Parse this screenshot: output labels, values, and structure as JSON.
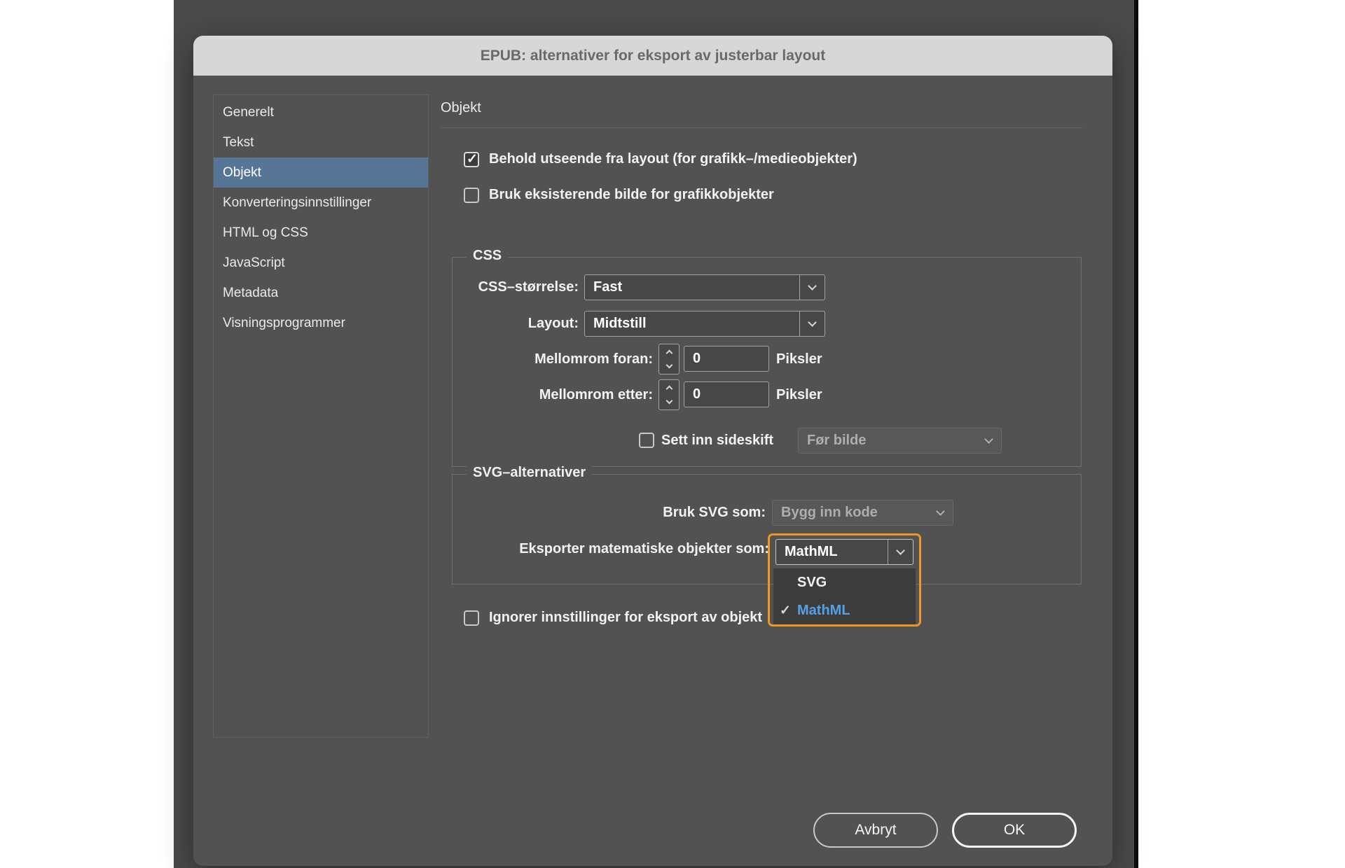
{
  "window": {
    "title": "EPUB: alternativer for eksport av justerbar layout"
  },
  "sidebar": {
    "items": [
      "Generelt",
      "Tekst",
      "Objekt",
      "Konverteringsinnstillinger",
      "HTML og CSS",
      "JavaScript",
      "Metadata",
      "Visningsprogrammer"
    ],
    "selected": "Objekt"
  },
  "panel": {
    "heading": "Objekt",
    "preserve_appearance": {
      "label": "Behold utseende fra layout (for grafikk–/medieobjekter)",
      "checked": true
    },
    "use_existing_image": {
      "label": "Bruk eksisterende bilde for grafikkobjekter",
      "checked": false
    },
    "css": {
      "legend": "CSS",
      "size_label": "CSS–størrelse:",
      "size_value": "Fast",
      "layout_label": "Layout:",
      "layout_value": "Midtstill",
      "space_before_label": "Mellomrom foran:",
      "space_before_value": "0",
      "space_before_unit": "Piksler",
      "space_after_label": "Mellomrom etter:",
      "space_after_value": "0",
      "space_after_unit": "Piksler",
      "page_break_label": "Sett inn sideskift",
      "page_break_value": "Før bilde",
      "page_break_checked": false
    },
    "svg": {
      "legend": "SVG–alternativer",
      "use_svg_label": "Bruk SVG som:",
      "use_svg_value": "Bygg inn kode",
      "export_math_label": "Eksporter matematiske objekter som:",
      "export_math_value": "MathML",
      "options": [
        {
          "label": "SVG",
          "selected": false
        },
        {
          "label": "MathML",
          "selected": true
        }
      ]
    },
    "ignore_export": {
      "label": "Ignorer innstillinger for eksport av objekt",
      "checked": false
    },
    "buttons": {
      "cancel": "Avbryt",
      "ok": "OK"
    }
  },
  "colors": {
    "selection_blue": "#577596",
    "focus_ring_orange": "#ED9722",
    "selected_option_text": "#55A1E8",
    "titlebar_bg": "#D7D7D7",
    "dialog_bg": "#525252"
  }
}
